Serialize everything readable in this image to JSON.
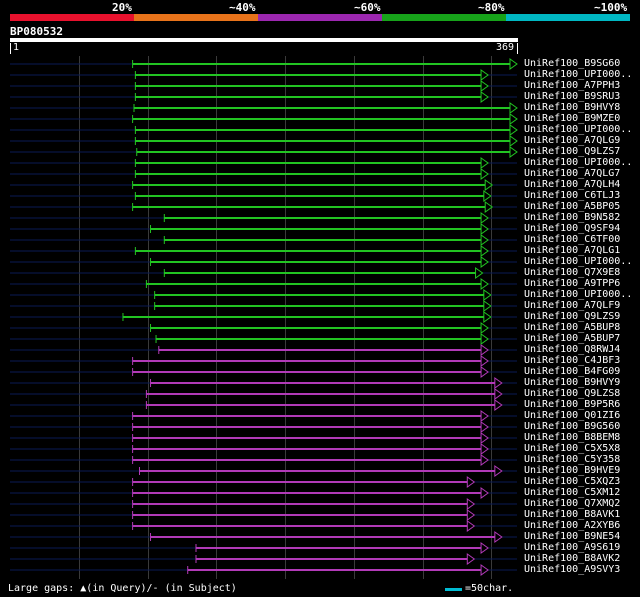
{
  "identity_bar": {
    "labels": [
      "20%",
      "~40%",
      "~60%",
      "~80%",
      "~100%"
    ],
    "colors": [
      "#e8112d",
      "#e8731a",
      "#9c27b0",
      "#17a31a",
      "#00b7c3"
    ]
  },
  "query": {
    "title": "BP080532",
    "start": "1",
    "end": "369",
    "length": 369
  },
  "hits": [
    {
      "name": "UniRef100_B9SG60",
      "start": 90,
      "end": 369,
      "color": "green"
    },
    {
      "name": "UniRef100_UPI000..",
      "start": 92,
      "end": 348,
      "color": "green"
    },
    {
      "name": "UniRef100_A7PPH3",
      "start": 92,
      "end": 348,
      "color": "green"
    },
    {
      "name": "UniRef100_B9SRU3",
      "start": 92,
      "end": 348,
      "color": "green"
    },
    {
      "name": "UniRef100_B9HVY8",
      "start": 91,
      "end": 369,
      "color": "green"
    },
    {
      "name": "UniRef100_B9MZE0",
      "start": 90,
      "end": 369,
      "color": "green"
    },
    {
      "name": "UniRef100_UPI000..",
      "start": 92,
      "end": 369,
      "color": "green"
    },
    {
      "name": "UniRef100_A7QLG9",
      "start": 92,
      "end": 369,
      "color": "green"
    },
    {
      "name": "UniRef100_Q9LZS7",
      "start": 93,
      "end": 369,
      "color": "green"
    },
    {
      "name": "UniRef100_UPI000..",
      "start": 92,
      "end": 348,
      "color": "green"
    },
    {
      "name": "UniRef100_A7QLG7",
      "start": 92,
      "end": 348,
      "color": "green"
    },
    {
      "name": "UniRef100_A7QLH4",
      "start": 90,
      "end": 351,
      "color": "green"
    },
    {
      "name": "UniRef100_C6TLJ3",
      "start": 92,
      "end": 350,
      "color": "green"
    },
    {
      "name": "UniRef100_A5BP05",
      "start": 90,
      "end": 351,
      "color": "green"
    },
    {
      "name": "UniRef100_B9N582",
      "start": 113,
      "end": 348,
      "color": "green"
    },
    {
      "name": "UniRef100_Q9SF94",
      "start": 103,
      "end": 348,
      "color": "green"
    },
    {
      "name": "UniRef100_C6TF00",
      "start": 113,
      "end": 348,
      "color": "green"
    },
    {
      "name": "UniRef100_A7QLG1",
      "start": 92,
      "end": 348,
      "color": "green"
    },
    {
      "name": "UniRef100_UPI000..",
      "start": 103,
      "end": 348,
      "color": "green"
    },
    {
      "name": "UniRef100_Q7X9E8",
      "start": 113,
      "end": 344,
      "color": "green"
    },
    {
      "name": "UniRef100_A9TPP6",
      "start": 100,
      "end": 348,
      "color": "green"
    },
    {
      "name": "UniRef100_UPI000..",
      "start": 106,
      "end": 350,
      "color": "green"
    },
    {
      "name": "UniRef100_A7QLF9",
      "start": 106,
      "end": 350,
      "color": "green"
    },
    {
      "name": "UniRef100_Q9LZS9",
      "start": 83,
      "end": 350,
      "color": "green"
    },
    {
      "name": "UniRef100_A5BUP8",
      "start": 103,
      "end": 348,
      "color": "green"
    },
    {
      "name": "UniRef100_A5BUP7",
      "start": 107,
      "end": 348,
      "color": "green"
    },
    {
      "name": "UniRef100_Q8RWJ4",
      "start": 109,
      "end": 348,
      "color": "purple"
    },
    {
      "name": "UniRef100_C4JBF3",
      "start": 90,
      "end": 348,
      "color": "purple"
    },
    {
      "name": "UniRef100_B4FG09",
      "start": 90,
      "end": 348,
      "color": "purple"
    },
    {
      "name": "UniRef100_B9HVY9",
      "start": 103,
      "end": 358,
      "color": "purple"
    },
    {
      "name": "UniRef100_Q9LZS8",
      "start": 100,
      "end": 358,
      "color": "purple"
    },
    {
      "name": "UniRef100_B9P5R6",
      "start": 100,
      "end": 358,
      "color": "purple"
    },
    {
      "name": "UniRef100_Q01ZI6",
      "start": 90,
      "end": 348,
      "color": "purple"
    },
    {
      "name": "UniRef100_B9G560",
      "start": 90,
      "end": 348,
      "color": "purple"
    },
    {
      "name": "UniRef100_B8BEM8",
      "start": 90,
      "end": 348,
      "color": "purple"
    },
    {
      "name": "UniRef100_C5X5X8",
      "start": 90,
      "end": 348,
      "color": "purple"
    },
    {
      "name": "UniRef100_C5Y358",
      "start": 90,
      "end": 348,
      "color": "purple"
    },
    {
      "name": "UniRef100_B9HVE9",
      "start": 95,
      "end": 358,
      "color": "purple"
    },
    {
      "name": "UniRef100_C5XQZ3",
      "start": 90,
      "end": 338,
      "color": "purple"
    },
    {
      "name": "UniRef100_C5XM12",
      "start": 90,
      "end": 348,
      "color": "purple"
    },
    {
      "name": "UniRef100_Q7XMQ2",
      "start": 90,
      "end": 338,
      "color": "purple"
    },
    {
      "name": "UniRef100_B8AVK1",
      "start": 90,
      "end": 338,
      "color": "purple"
    },
    {
      "name": "UniRef100_A2XYB6",
      "start": 90,
      "end": 338,
      "color": "purple"
    },
    {
      "name": "UniRef100_B9NE54",
      "start": 103,
      "end": 358,
      "color": "purple"
    },
    {
      "name": "UniRef100_A9S619",
      "start": 136,
      "end": 348,
      "color": "purple"
    },
    {
      "name": "UniRef100_B8AVK2",
      "start": 136,
      "end": 338,
      "color": "purple"
    },
    {
      "name": "UniRef100_A9SVY3",
      "start": 130,
      "end": 348,
      "color": "purple"
    }
  ],
  "legend": {
    "gaps_label": "Large gaps:",
    "query_gap": "(in Query)/",
    "subject_gap": "- (in Subject)",
    "scale_label": "=50char."
  },
  "colors": {
    "green": "#22c422",
    "purple": "#b23ab8",
    "background": "#000000",
    "track": "#0a1a55"
  }
}
